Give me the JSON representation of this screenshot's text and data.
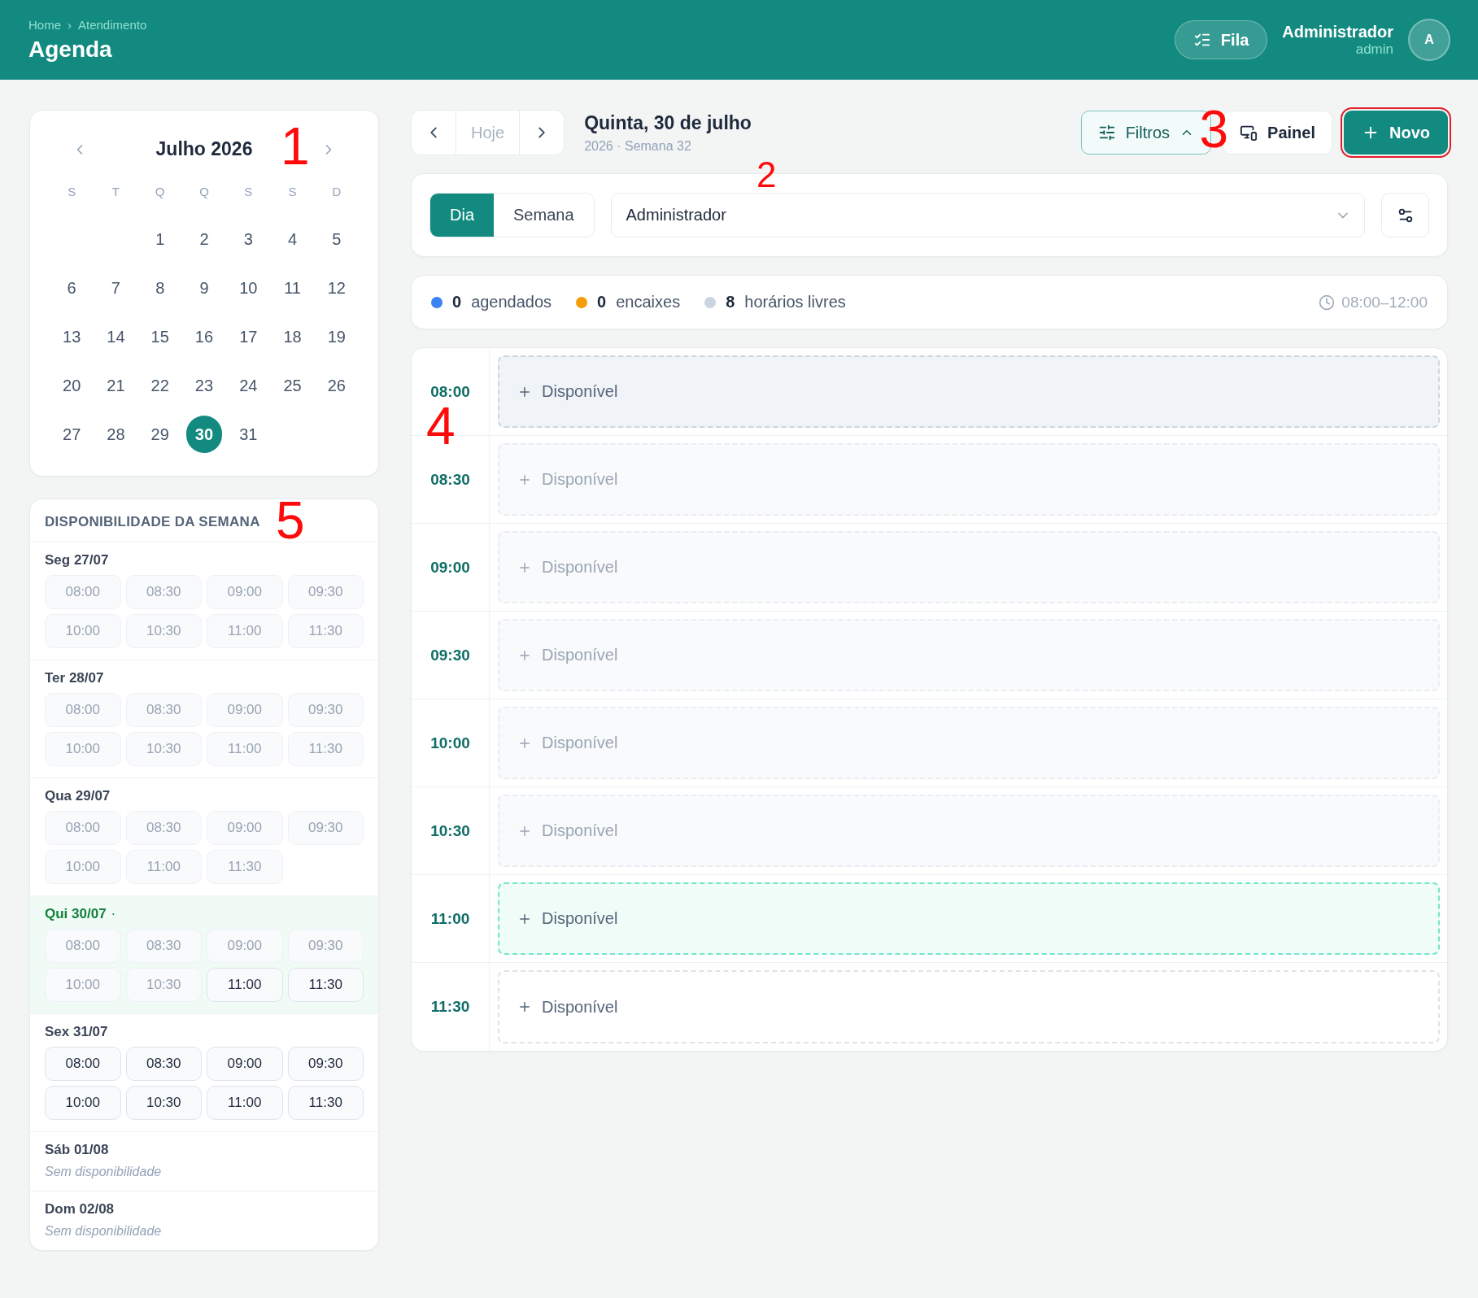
{
  "header": {
    "breadcrumb": [
      "Home",
      "Atendimento"
    ],
    "breadcrumb_separator": "›",
    "title": "Agenda",
    "queue_button": "Fila",
    "user": {
      "name": "Administrador",
      "role": "admin",
      "initial": "A"
    }
  },
  "calendar": {
    "annotation": "1",
    "month": "Julho 2026",
    "weekdays": [
      "S",
      "T",
      "Q",
      "Q",
      "S",
      "S",
      "D"
    ],
    "weeks": [
      [
        {
          "kind": "blank"
        },
        {
          "kind": "blank"
        },
        {
          "kind": "day",
          "day": "1",
          "selected": false
        },
        {
          "kind": "day",
          "day": "2",
          "selected": false
        },
        {
          "kind": "day",
          "day": "3",
          "selected": false
        },
        {
          "kind": "day",
          "day": "4",
          "selected": false
        },
        {
          "kind": "day",
          "day": "5",
          "selected": false
        }
      ],
      [
        {
          "kind": "day",
          "day": "6",
          "selected": false
        },
        {
          "kind": "day",
          "day": "7",
          "selected": false
        },
        {
          "kind": "day",
          "day": "8",
          "selected": false
        },
        {
          "kind": "day",
          "day": "9",
          "selected": false
        },
        {
          "kind": "day",
          "day": "10",
          "selected": false
        },
        {
          "kind": "day",
          "day": "11",
          "selected": false
        },
        {
          "kind": "day",
          "day": "12",
          "selected": false
        }
      ],
      [
        {
          "kind": "day",
          "day": "13",
          "selected": false
        },
        {
          "kind": "day",
          "day": "14",
          "selected": false
        },
        {
          "kind": "day",
          "day": "15",
          "selected": false
        },
        {
          "kind": "day",
          "day": "16",
          "selected": false
        },
        {
          "kind": "day",
          "day": "17",
          "selected": false
        },
        {
          "kind": "day",
          "day": "18",
          "selected": false
        },
        {
          "kind": "day",
          "day": "19",
          "selected": false
        }
      ],
      [
        {
          "kind": "day",
          "day": "20",
          "selected": false
        },
        {
          "kind": "day",
          "day": "21",
          "selected": false
        },
        {
          "kind": "day",
          "day": "22",
          "selected": false
        },
        {
          "kind": "day",
          "day": "23",
          "selected": false
        },
        {
          "kind": "day",
          "day": "24",
          "selected": false
        },
        {
          "kind": "day",
          "day": "25",
          "selected": false
        },
        {
          "kind": "day",
          "day": "26",
          "selected": false
        }
      ],
      [
        {
          "kind": "day",
          "day": "27",
          "selected": false
        },
        {
          "kind": "day",
          "day": "28",
          "selected": false
        },
        {
          "kind": "day",
          "day": "29",
          "selected": false
        },
        {
          "kind": "day",
          "day": "30",
          "selected": true
        },
        {
          "kind": "day",
          "day": "31",
          "selected": false
        },
        {
          "kind": "blank"
        },
        {
          "kind": "blank"
        }
      ]
    ]
  },
  "availability": {
    "annotation": "5",
    "title": "DISPONIBILIDADE DA SEMANA",
    "days": [
      {
        "label": "Seg 27/07",
        "today": false,
        "slots": [
          {
            "time": "08:00",
            "available": false
          },
          {
            "time": "08:30",
            "available": false
          },
          {
            "time": "09:00",
            "available": false
          },
          {
            "time": "09:30",
            "available": false
          },
          {
            "time": "10:00",
            "available": false
          },
          {
            "time": "10:30",
            "available": false
          },
          {
            "time": "11:00",
            "available": false
          },
          {
            "time": "11:30",
            "available": false
          }
        ]
      },
      {
        "label": "Ter 28/07",
        "today": false,
        "slots": [
          {
            "time": "08:00",
            "available": false
          },
          {
            "time": "08:30",
            "available": false
          },
          {
            "time": "09:00",
            "available": false
          },
          {
            "time": "09:30",
            "available": false
          },
          {
            "time": "10:00",
            "available": false
          },
          {
            "time": "10:30",
            "available": false
          },
          {
            "time": "11:00",
            "available": false
          },
          {
            "time": "11:30",
            "available": false
          }
        ]
      },
      {
        "label": "Qua 29/07",
        "today": false,
        "slots": [
          {
            "time": "08:00",
            "available": false
          },
          {
            "time": "08:30",
            "available": false
          },
          {
            "time": "09:00",
            "available": false
          },
          {
            "time": "09:30",
            "available": false
          },
          {
            "time": "10:00",
            "available": false
          },
          {
            "time": "11:00",
            "available": false
          },
          {
            "time": "11:30",
            "available": false
          }
        ]
      },
      {
        "label": "Qui 30/07",
        "today": true,
        "today_mark": "·",
        "slots": [
          {
            "time": "08:00",
            "available": false
          },
          {
            "time": "08:30",
            "available": false
          },
          {
            "time": "09:00",
            "available": false
          },
          {
            "time": "09:30",
            "available": false
          },
          {
            "time": "10:00",
            "available": false
          },
          {
            "time": "10:30",
            "available": false
          },
          {
            "time": "11:00",
            "available": true
          },
          {
            "time": "11:30",
            "available": true
          }
        ]
      },
      {
        "label": "Sex 31/07",
        "today": false,
        "slots": [
          {
            "time": "08:00",
            "available": true
          },
          {
            "time": "08:30",
            "available": true
          },
          {
            "time": "09:00",
            "available": true
          },
          {
            "time": "09:30",
            "available": true
          },
          {
            "time": "10:00",
            "available": true
          },
          {
            "time": "10:30",
            "available": true
          },
          {
            "time": "11:00",
            "available": true
          },
          {
            "time": "11:30",
            "available": true
          }
        ]
      },
      {
        "label": "Sáb 01/08",
        "today": false,
        "empty_text": "Sem disponibilidade"
      },
      {
        "label": "Dom 02/08",
        "today": false,
        "empty_text": "Sem disponibilidade"
      }
    ]
  },
  "toolbar": {
    "annotation": "3",
    "today_button": "Hoje",
    "date_title": "Quinta, 30 de julho",
    "date_subtitle": "2026 · Semana 32",
    "filters_button": "Filtros",
    "panel_button": "Painel",
    "new_button": {
      "label": "Novo",
      "outlined": true
    }
  },
  "controls": {
    "annotation": "2",
    "views": [
      {
        "label": "Dia",
        "selected": true
      },
      {
        "label": "Semana",
        "selected": false
      }
    ],
    "professional": "Administrador"
  },
  "summary": {
    "items": [
      {
        "count": "0",
        "label": "agendados",
        "color": "#3b82f6"
      },
      {
        "count": "0",
        "label": "encaixes",
        "color": "#f59e0b"
      },
      {
        "count": "8",
        "label": "horários livres",
        "color": "#cbd5e1"
      }
    ],
    "hours": "08:00–12:00"
  },
  "schedule": {
    "annotation": "4",
    "slots": [
      {
        "time": "08:00",
        "label": "Disponível",
        "kind": "hover"
      },
      {
        "time": "08:30",
        "label": "Disponível",
        "kind": "past"
      },
      {
        "time": "09:00",
        "label": "Disponível",
        "kind": "past"
      },
      {
        "time": "09:30",
        "label": "Disponível",
        "kind": "past"
      },
      {
        "time": "10:00",
        "label": "Disponível",
        "kind": "past"
      },
      {
        "time": "10:30",
        "label": "Disponível",
        "kind": "past"
      },
      {
        "time": "11:00",
        "label": "Disponível",
        "kind": "current"
      },
      {
        "time": "11:30",
        "label": "Disponível",
        "kind": "free"
      }
    ]
  }
}
